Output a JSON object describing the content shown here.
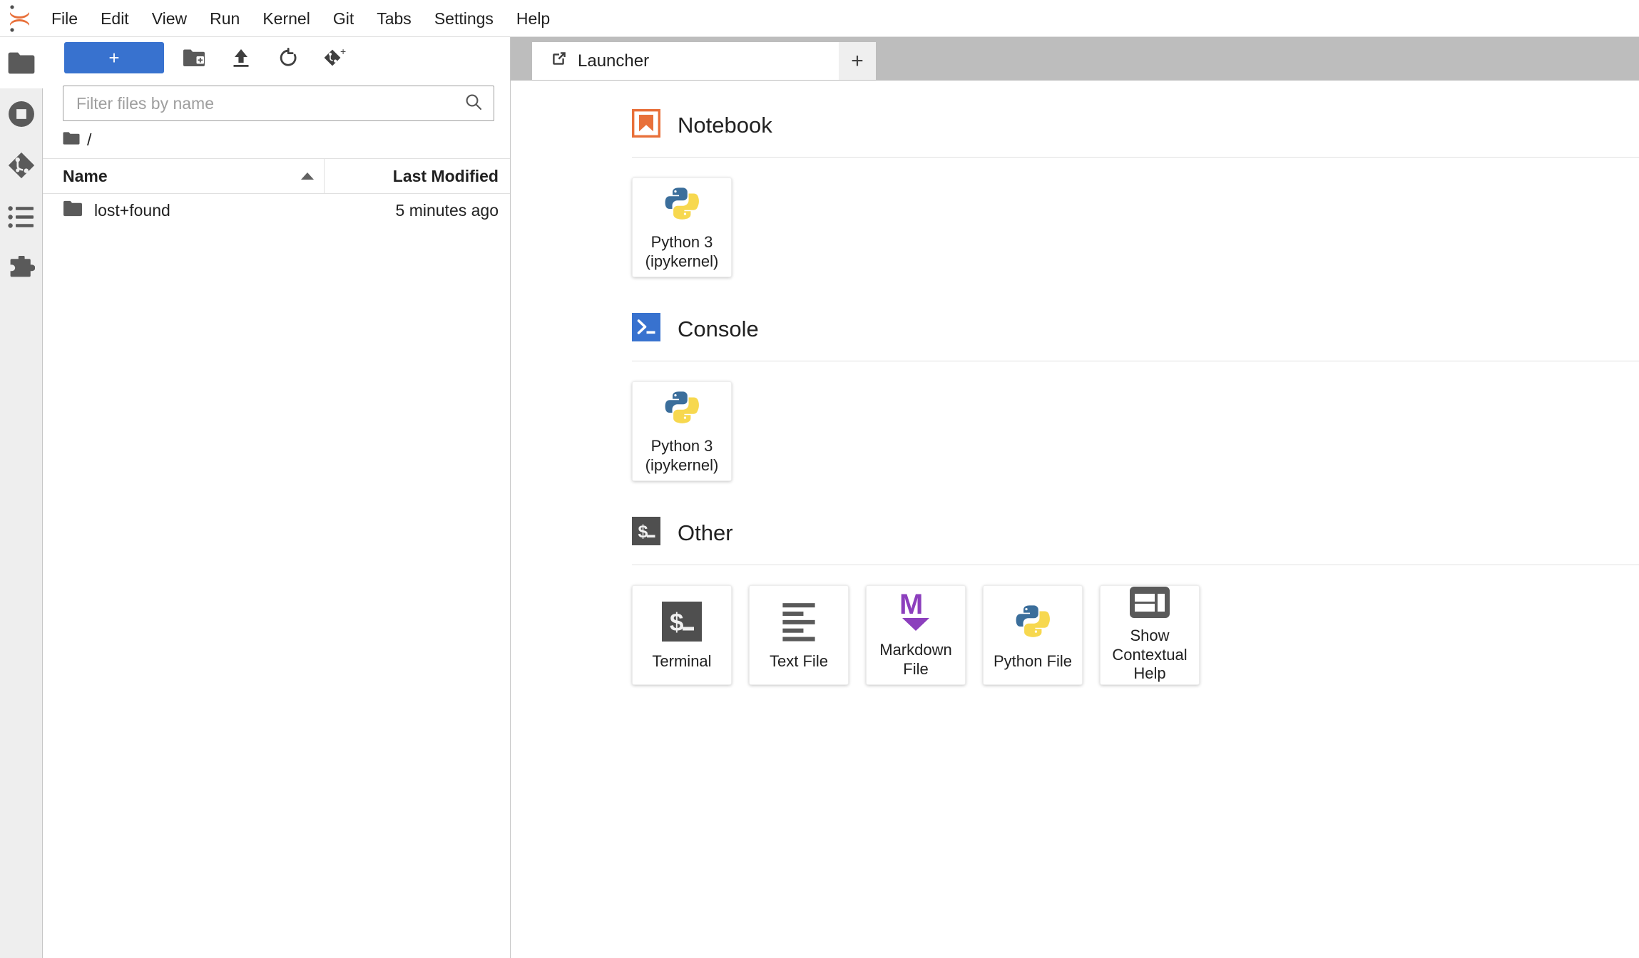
{
  "app": {
    "logo_icon": "jupyter-logo-icon"
  },
  "menubar": {
    "items": [
      {
        "label": "File",
        "name": "menu-file"
      },
      {
        "label": "Edit",
        "name": "menu-edit"
      },
      {
        "label": "View",
        "name": "menu-view"
      },
      {
        "label": "Run",
        "name": "menu-run"
      },
      {
        "label": "Kernel",
        "name": "menu-kernel"
      },
      {
        "label": "Git",
        "name": "menu-git"
      },
      {
        "label": "Tabs",
        "name": "menu-tabs"
      },
      {
        "label": "Settings",
        "name": "menu-settings"
      },
      {
        "label": "Help",
        "name": "menu-help"
      }
    ]
  },
  "sidebar_rail": {
    "items": [
      {
        "icon": "folder-icon",
        "name": "sidebar-item-file-browser",
        "active": true
      },
      {
        "icon": "running-stop-icon",
        "name": "sidebar-item-running",
        "active": false
      },
      {
        "icon": "git-icon",
        "name": "sidebar-item-git",
        "active": false
      },
      {
        "icon": "toc-list-icon",
        "name": "sidebar-item-table-of-contents",
        "active": false
      },
      {
        "icon": "puzzle-icon",
        "name": "sidebar-item-extensions",
        "active": false
      }
    ]
  },
  "file_browser": {
    "toolbar": {
      "new_launcher_label": "+",
      "new_folder_icon": "new-folder-icon",
      "upload_icon": "upload-icon",
      "refresh_icon": "refresh-icon",
      "git_clone_icon": "git-clone-icon"
    },
    "filter": {
      "value": "",
      "placeholder": "Filter files by name",
      "search_icon": "search-icon"
    },
    "breadcrumb": {
      "home_icon": "folder-icon",
      "path": "/"
    },
    "columns": {
      "name": "Name",
      "last_modified": "Last Modified",
      "sort_direction": "ascending"
    },
    "rows": [
      {
        "icon": "folder-icon",
        "name": "lost+found",
        "last_modified": "5 minutes ago"
      }
    ]
  },
  "tabbar": {
    "tabs": [
      {
        "label": "Launcher",
        "icon": "launcher-icon",
        "active": true
      }
    ],
    "add_tab_label": "+"
  },
  "launcher": {
    "sections": [
      {
        "title": "Notebook",
        "icon": "notebook-bookmark-icon",
        "cards": [
          {
            "label": "Python 3\n(ipykernel)",
            "icon": "python-logo-icon",
            "name": "launcher-card-notebook-python3"
          }
        ]
      },
      {
        "title": "Console",
        "icon": "console-prompt-icon",
        "cards": [
          {
            "label": "Python 3\n(ipykernel)",
            "icon": "python-logo-icon",
            "name": "launcher-card-console-python3"
          }
        ]
      },
      {
        "title": "Other",
        "icon": "terminal-dollar-icon",
        "cards": [
          {
            "label": "Terminal",
            "icon": "terminal-dollar-icon",
            "name": "launcher-card-terminal"
          },
          {
            "label": "Text File",
            "icon": "text-file-icon",
            "name": "launcher-card-text-file"
          },
          {
            "label": "Markdown File",
            "icon": "markdown-icon",
            "name": "launcher-card-markdown-file"
          },
          {
            "label": "Python File",
            "icon": "python-logo-icon",
            "name": "launcher-card-python-file"
          },
          {
            "label": "Show\nContextual Help",
            "icon": "contextual-help-icon",
            "name": "launcher-card-contextual-help"
          }
        ]
      }
    ]
  },
  "colors": {
    "accent_blue": "#3872cf",
    "notebook_orange": "#e8703a",
    "console_blue": "#3872cf",
    "terminal_dark": "#4f4f4f",
    "markdown_purple": "#8c3fbd",
    "python_blue": "#3b6e9b",
    "python_yellow": "#f7d84f",
    "tabbar_gray": "#bdbdbd",
    "rail_gray": "#eeeeee"
  }
}
